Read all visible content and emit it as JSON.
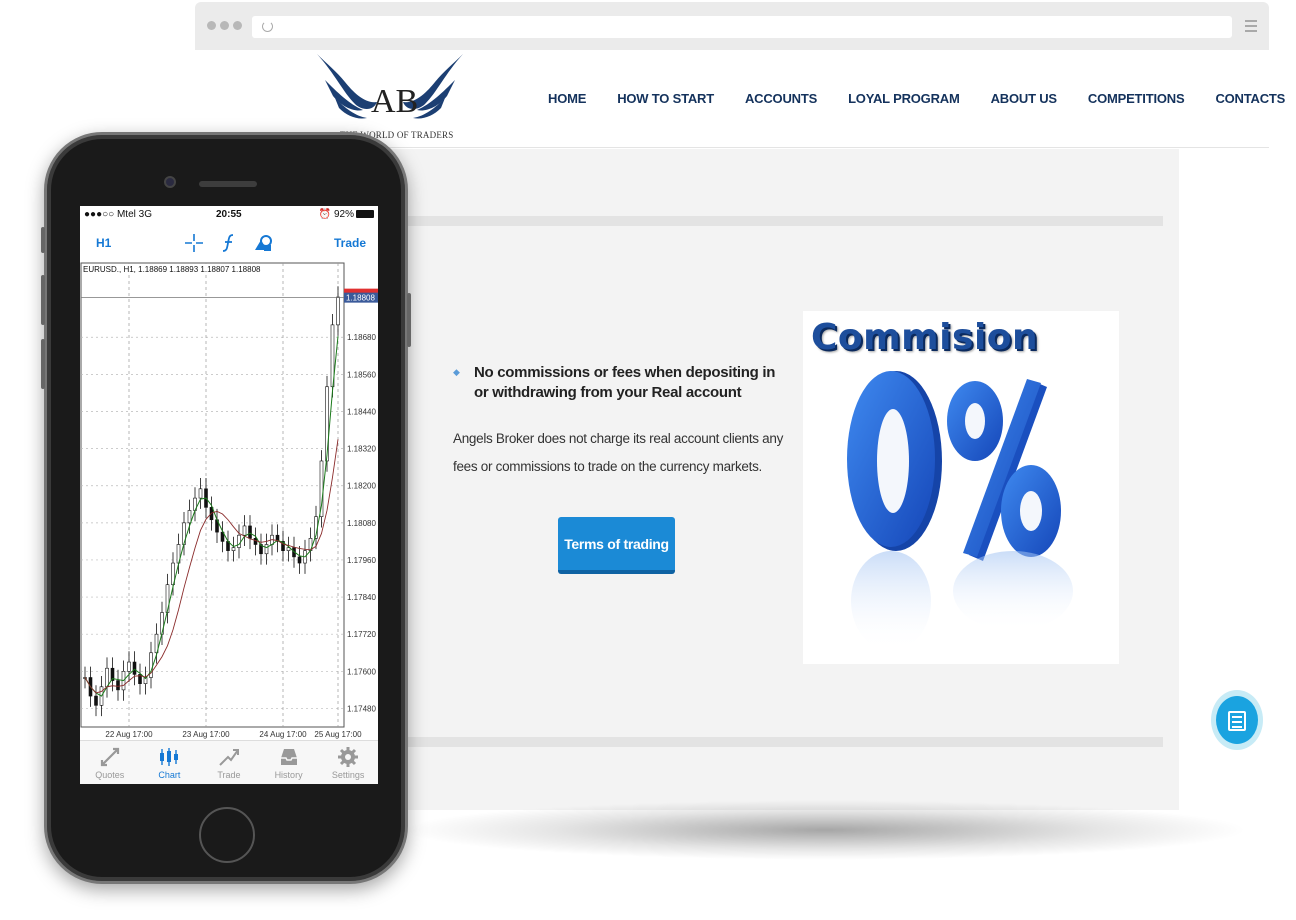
{
  "browser": {
    "url": ""
  },
  "site": {
    "logo_letters": "AB",
    "logo_tagline": "THE WORLD OF TRADERS",
    "nav": [
      {
        "label": "HOME"
      },
      {
        "label": "HOW TO START"
      },
      {
        "label": "ACCOUNTS"
      },
      {
        "label": "LOYAL PROGRAM"
      },
      {
        "label": "ABOUT US"
      },
      {
        "label": "COMPETITIONS"
      },
      {
        "label": "CONTACTS"
      }
    ],
    "bullet": "No commissions or fees when depositing in or withdrawing from your Real account",
    "paragraph": "Angels Broker does not charge its real account clients any fees or commissions to trade on the currency markets.",
    "cta": "Terms of trading",
    "promo_title": "Commision",
    "promo_value": "0%",
    "colors": {
      "nav": "#14325c",
      "accent": "#1b8ad6",
      "fab": "#1aa3e0"
    }
  },
  "phone": {
    "status": {
      "carrier": "●●●○○ Mtel   3G",
      "time": "20:55",
      "battery": "92%"
    },
    "toolbar": {
      "timeframe": "H1",
      "trade": "Trade",
      "icons": [
        "crosshair-icon",
        "function-icon",
        "objects-icon"
      ]
    },
    "chart_header": "EURUSD., H1, 1.18869 1.18893 1.18807 1.18808",
    "price_labels": [
      "1.18680",
      "1.18560",
      "1.18440",
      "1.18320",
      "1.18200",
      "1.18080",
      "1.17960",
      "1.17840",
      "1.17720",
      "1.17600",
      "1.17480"
    ],
    "current_price": "1.18808",
    "date_labels": [
      "22 Aug 17:00",
      "23 Aug 17:00",
      "24 Aug 17:00",
      "25 Aug 17:00"
    ],
    "tabs": [
      {
        "label": "Quotes",
        "icon": "quotes-icon",
        "active": false
      },
      {
        "label": "Chart",
        "icon": "chart-icon",
        "active": true
      },
      {
        "label": "Trade",
        "icon": "trade-icon",
        "active": false
      },
      {
        "label": "History",
        "icon": "history-icon",
        "active": false
      },
      {
        "label": "Settings",
        "icon": "settings-icon",
        "active": false
      }
    ]
  },
  "chart_data": {
    "type": "line",
    "title": "EURUSD., H1, 1.18869 1.18893 1.18807 1.18808",
    "xlabel": "",
    "ylabel": "",
    "categories": [
      "22 Aug 17:00",
      "23 Aug 17:00",
      "24 Aug 17:00",
      "25 Aug 17:00"
    ],
    "ylim": [
      1.1742,
      1.1892
    ],
    "series": [
      {
        "values": [
          1.1758,
          1.1752,
          1.1749,
          1.1755,
          1.1761,
          1.1757,
          1.1754,
          1.176,
          1.1763,
          1.1759,
          1.1756,
          1.1758,
          1.1766,
          1.1772,
          1.1779,
          1.1788,
          1.1795,
          1.1801,
          1.1808,
          1.1812,
          1.1816,
          1.1819,
          1.1813,
          1.1809,
          1.1805,
          1.1802,
          1.1799,
          1.18,
          1.1804,
          1.1807,
          1.1803,
          1.1801,
          1.1798,
          1.1801,
          1.1804,
          1.1802,
          1.1799,
          1.18,
          1.1797,
          1.1795,
          1.1799,
          1.1803,
          1.181,
          1.1828,
          1.1852,
          1.1872,
          1.1881
        ]
      }
    ],
    "grid": true,
    "legend": "none"
  }
}
